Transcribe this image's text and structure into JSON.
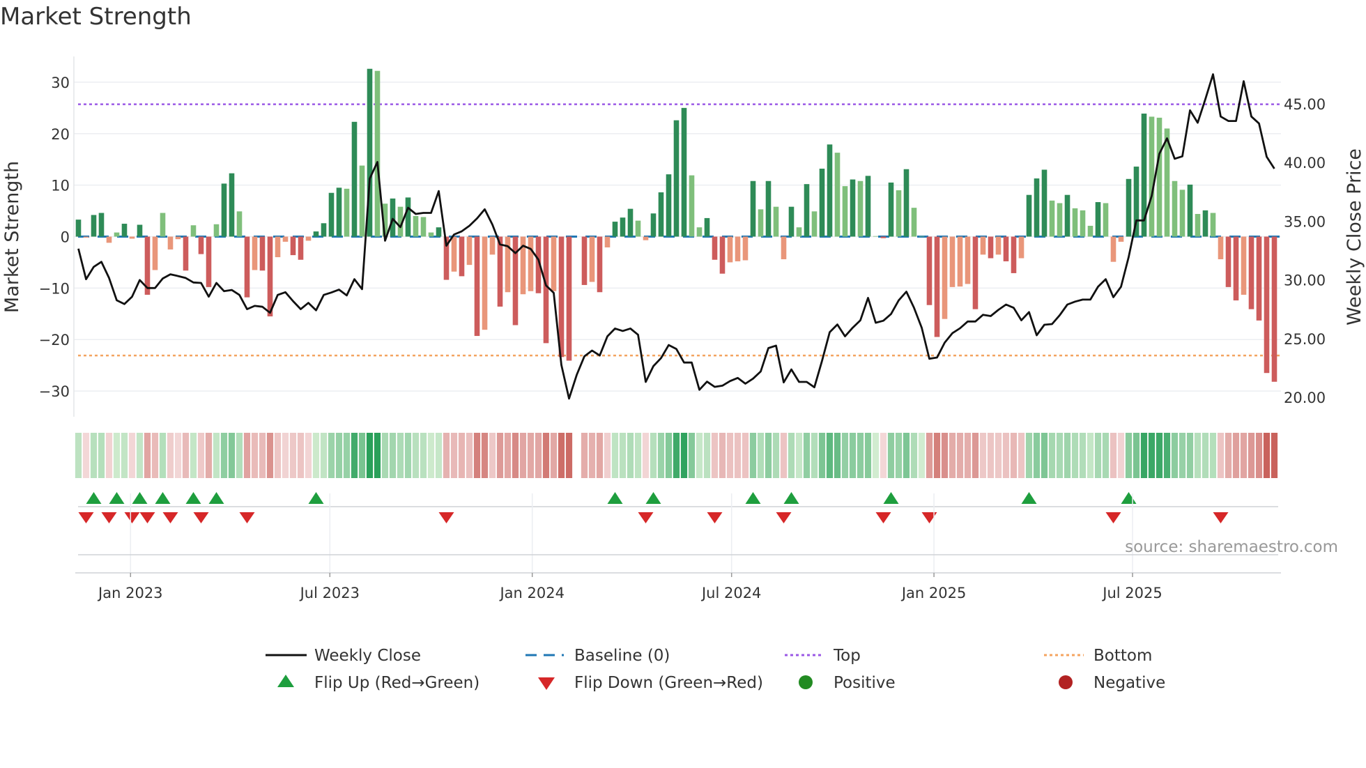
{
  "title": "Market Strength",
  "source": "source: sharemaestro.com",
  "legend": {
    "weekly_close": "Weekly Close",
    "baseline": "Baseline (0)",
    "top": "Top",
    "bottom": "Bottom",
    "flip_up": "Flip Up (Red→Green)",
    "flip_down": "Flip Down (Green→Red)",
    "positive": "Positive",
    "negative": "Negative"
  },
  "colors": {
    "strong_green": "#2e8b57",
    "weak_green": "#7fbf7b",
    "strong_red": "#cd5c5c",
    "weak_red": "#e9967a",
    "close_line": "#111111",
    "baseline": "#1f77b4",
    "top": "#9b59e6",
    "bottom": "#f4a460",
    "flip_up": "#1e9e3e",
    "flip_down": "#d62728",
    "positive": "#228b22",
    "negative": "#b22222"
  },
  "chart_data": {
    "type": "bar+line",
    "title": "Market Strength",
    "ylabel": "Market Strength",
    "y2label": "Weekly Close Price",
    "ylim": [
      -35,
      35
    ],
    "y2lim": [
      18.34,
      49.04
    ],
    "yticks": [
      -30,
      -20,
      -10,
      0,
      10,
      20,
      30
    ],
    "ytick_labels": [
      "−30",
      "−20",
      "−10",
      "0",
      "10",
      "20",
      "30"
    ],
    "y2ticks": [
      20,
      25,
      30,
      35,
      40,
      45
    ],
    "y2tick_labels": [
      "20.00",
      "25.00",
      "30.00",
      "35.00",
      "40.00",
      "45.00"
    ],
    "x_unit": "week index",
    "xlim": [
      -0.6,
      156.6
    ],
    "xticks": [
      {
        "label": "Jan 2023",
        "week": 6.8
      },
      {
        "label": "Jul 2023",
        "week": 32.8
      },
      {
        "label": "Jan 2024",
        "week": 59.2
      },
      {
        "label": "Jul 2024",
        "week": 85.2
      },
      {
        "label": "Jan 2025",
        "week": 111.6
      },
      {
        "label": "Jul 2025",
        "week": 137.5
      }
    ],
    "top_level": 25.7,
    "bottom_level": -23.1,
    "baseline": 0,
    "strength": [
      3.3,
      -0.2,
      4.2,
      4.6,
      -1.2,
      0.8,
      2.5,
      -0.4,
      2.3,
      -11.3,
      -6.5,
      4.6,
      -2.5,
      -0.5,
      -6.6,
      2.2,
      -3.4,
      -9.8,
      2.4,
      10.3,
      12.3,
      4.9,
      -11.8,
      -6.5,
      -6.6,
      -15.5,
      -4,
      -1,
      -3.6,
      -4.5,
      -0.8,
      1,
      2.6,
      8.5,
      9.5,
      9.3,
      22.3,
      13.8,
      32.6,
      32.2,
      6.4,
      7.4,
      5.8,
      7.6,
      4,
      3.8,
      0.8,
      1.8,
      -8.4,
      -6.8,
      -7.7,
      -5.5,
      -19.3,
      -18.1,
      -3.5,
      -13.6,
      -10.8,
      -17.2,
      -11.2,
      -10.6,
      -11,
      -20.7,
      -10.6,
      -23.4,
      -24.1,
      null,
      -9.4,
      -8.8,
      -10.8,
      -2.1,
      2.9,
      3.7,
      5.4,
      3.1,
      -0.7,
      4.5,
      8.6,
      12.1,
      22.6,
      25,
      11.9,
      1.8,
      3.6,
      -4.5,
      -7.2,
      -5,
      -4.8,
      -4.6,
      10.8,
      5.3,
      10.8,
      5.8,
      -4.4,
      5.8,
      1.8,
      10.2,
      4.9,
      13.2,
      17.9,
      16.3,
      9.8,
      11.1,
      10.8,
      11.8,
      0.1,
      -0.3,
      10.5,
      9,
      13.1,
      5.6,
      0.1,
      -13.3,
      -19.5,
      -16,
      -9.8,
      -9.7,
      -9.2,
      -14.1,
      -3.5,
      -4.2,
      -3.5,
      -4.8,
      -7.1,
      -4.2,
      8.1,
      11.3,
      13,
      7,
      6.5,
      8.1,
      5.5,
      5.1,
      2.1,
      6.7,
      6.5,
      -4.9,
      -1,
      11.2,
      13.6,
      23.9,
      23.3,
      23.1,
      21,
      10.8,
      9.1,
      10.1,
      4.4,
      5.1,
      4.6,
      -4.4,
      -9.8,
      -12.4,
      -11.3,
      -14.1,
      -16.3,
      -26.5,
      -28.2
    ],
    "close": [
      32.66,
      30.06,
      31.11,
      31.54,
      30.16,
      28.26,
      27.94,
      28.57,
      29.99,
      29.31,
      29.31,
      30.12,
      30.48,
      30.33,
      30.16,
      29.78,
      29.74,
      28.57,
      29.74,
      29.04,
      29.14,
      28.72,
      27.51,
      27.79,
      27.71,
      27.2,
      28.72,
      28.95,
      28.19,
      27.51,
      28.04,
      27.41,
      28.72,
      28.93,
      29.17,
      28.68,
      30.06,
      29.21,
      38.63,
      40.05,
      33.34,
      35.2,
      34.5,
      36.15,
      35.62,
      35.71,
      35.71,
      37.57,
      32.91,
      33.87,
      34.14,
      34.61,
      35.24,
      36.02,
      34.71,
      33.02,
      32.87,
      32.28,
      32.91,
      32.64,
      31.73,
      29.53,
      28.89,
      22.75,
      19.89,
      21.91,
      23.49,
      23.98,
      23.56,
      25.19,
      25.86,
      25.65,
      25.86,
      25.33,
      21.31,
      22.65,
      23.34,
      24.45,
      24.11,
      22.96,
      22.96,
      20.64,
      21.33,
      20.89,
      20.99,
      21.38,
      21.65,
      21.16,
      21.59,
      22.2,
      24.19,
      24.4,
      21.27,
      22.37,
      21.31,
      21.31,
      20.85,
      23.11,
      25.55,
      26.2,
      25.19,
      25.93,
      26.56,
      28.47,
      26.35,
      26.52,
      27.09,
      28.26,
      29,
      27.62,
      25.93,
      23.28,
      23.39,
      24.66,
      25.46,
      25.88,
      26.46,
      26.46,
      27.03,
      26.92,
      27.45,
      27.9,
      27.62,
      26.56,
      27.26,
      25.29,
      26.18,
      26.24,
      26.99,
      27.9,
      28.15,
      28.32,
      28.32,
      29.42,
      30.06,
      28.53,
      29.42,
      31.96,
      35.07,
      35.07,
      37.15,
      40.75,
      42.06,
      40.32,
      40.53,
      44.45,
      43.39,
      45.4,
      47.52,
      43.92,
      43.54,
      43.54,
      46.93,
      43.92,
      43.33,
      40.49,
      39.48
    ],
    "flip_up_weeks": [
      2,
      5,
      8,
      11,
      15,
      18,
      31,
      70,
      75,
      88,
      93,
      106,
      124,
      137
    ],
    "flip_down_weeks": [
      1,
      4,
      7,
      9,
      12,
      16,
      22,
      48,
      74,
      83,
      92,
      105,
      111,
      135,
      149
    ],
    "legend_placement": "bottom"
  }
}
